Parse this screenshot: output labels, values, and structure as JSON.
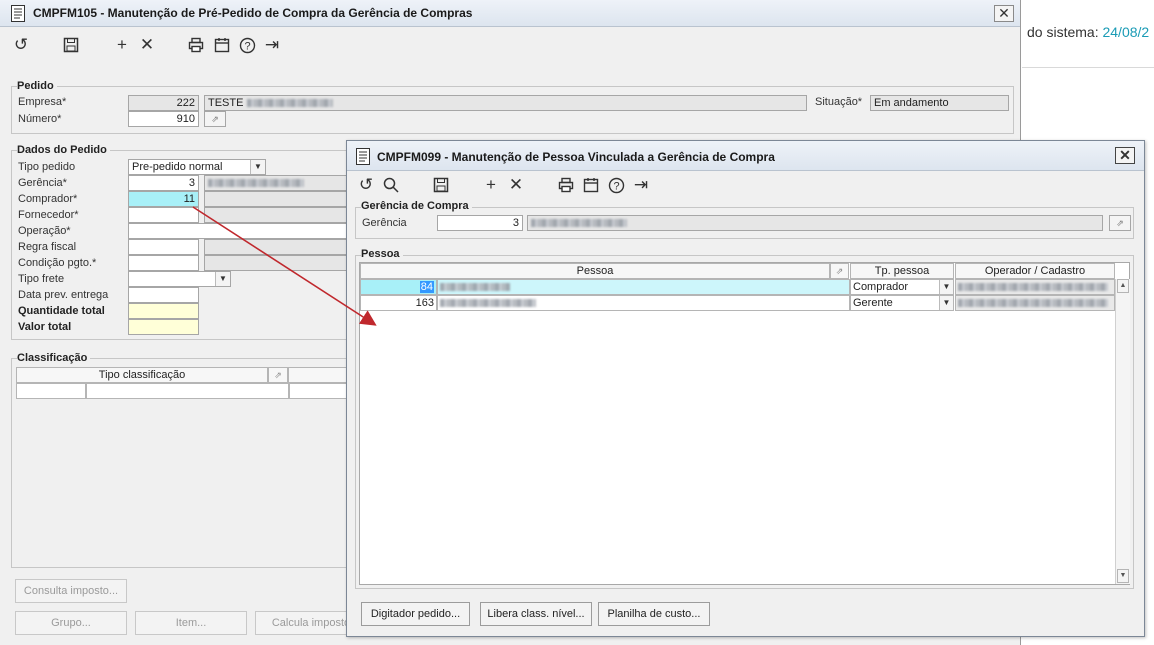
{
  "main_window": {
    "title": "CMPFM105 - Manutenção de Pré-Pedido de Compra da Gerência de Compras",
    "close": "✕",
    "toolbar": {
      "undo": "↺",
      "save": "🖫",
      "add": "+",
      "delete": "✕",
      "print": "⎙",
      "calendar": "▦",
      "help": "?",
      "exit": "⇥"
    },
    "pedido": {
      "title": "Pedido",
      "empresa_label": "Empresa*",
      "empresa_value": "222",
      "empresa_name": "TESTE",
      "numero_label": "Número*",
      "numero_value": "910",
      "situacao_label": "Situação*",
      "situacao_value": "Em andamento"
    },
    "dados": {
      "title": "Dados do Pedido",
      "tipo_pedido_label": "Tipo pedido",
      "tipo_pedido_value": "Pre-pedido normal",
      "gerencia_label": "Gerência*",
      "gerencia_value": "3",
      "comprador_label": "Comprador*",
      "comprador_value": "11",
      "fornecedor_label": "Fornecedor*",
      "operacao_label": "Operação*",
      "regra_fiscal_label": "Regra fiscal",
      "condicao_label": "Condição pgto.*",
      "tipo_frete_label": "Tipo frete",
      "data_prev_label": "Data prev. entrega",
      "qtd_total_label": "Quantidade total",
      "valor_total_label": "Valor total"
    },
    "classificacao": {
      "title": "Classificação",
      "col_tipo": "Tipo classificação"
    },
    "buttons": {
      "consulta_imposto": "Consulta imposto...",
      "grupo": "Grupo...",
      "item": "Item...",
      "calcula_imposto": "Calcula imposto"
    }
  },
  "right_panel": {
    "sistema_label": "do sistema:",
    "sistema_date": "24/08/2"
  },
  "modal": {
    "title": "CMPFM099 - Manutenção de Pessoa Vinculada a Gerência de Compra",
    "close": "✕",
    "toolbar": {
      "undo": "↺",
      "search": "⌕",
      "save": "🖫",
      "add": "+",
      "delete": "✕",
      "print": "⎙",
      "calendar": "▦",
      "help": "?",
      "exit": "⇥"
    },
    "gerencia_compra": {
      "title": "Gerência de Compra",
      "gerencia_label": "Gerência",
      "gerencia_value": "3"
    },
    "pessoa": {
      "title": "Pessoa",
      "columns": [
        "Pessoa",
        "Tp. pessoa",
        "Operador / Cadastro"
      ],
      "rows": [
        {
          "code": "84",
          "tipo": "Comprador"
        },
        {
          "code": "163",
          "tipo": "Gerente"
        }
      ]
    },
    "buttons": {
      "digitador": "Digitador pedido...",
      "libera": "Libera class. nível...",
      "planilha": "Planilha de custo..."
    }
  },
  "colors": {
    "selected_cell": "#a8f0f8",
    "total_field": "#ffffd8",
    "annotation_arrow": "#c0282d",
    "date_accent": "#1a9bb5"
  }
}
